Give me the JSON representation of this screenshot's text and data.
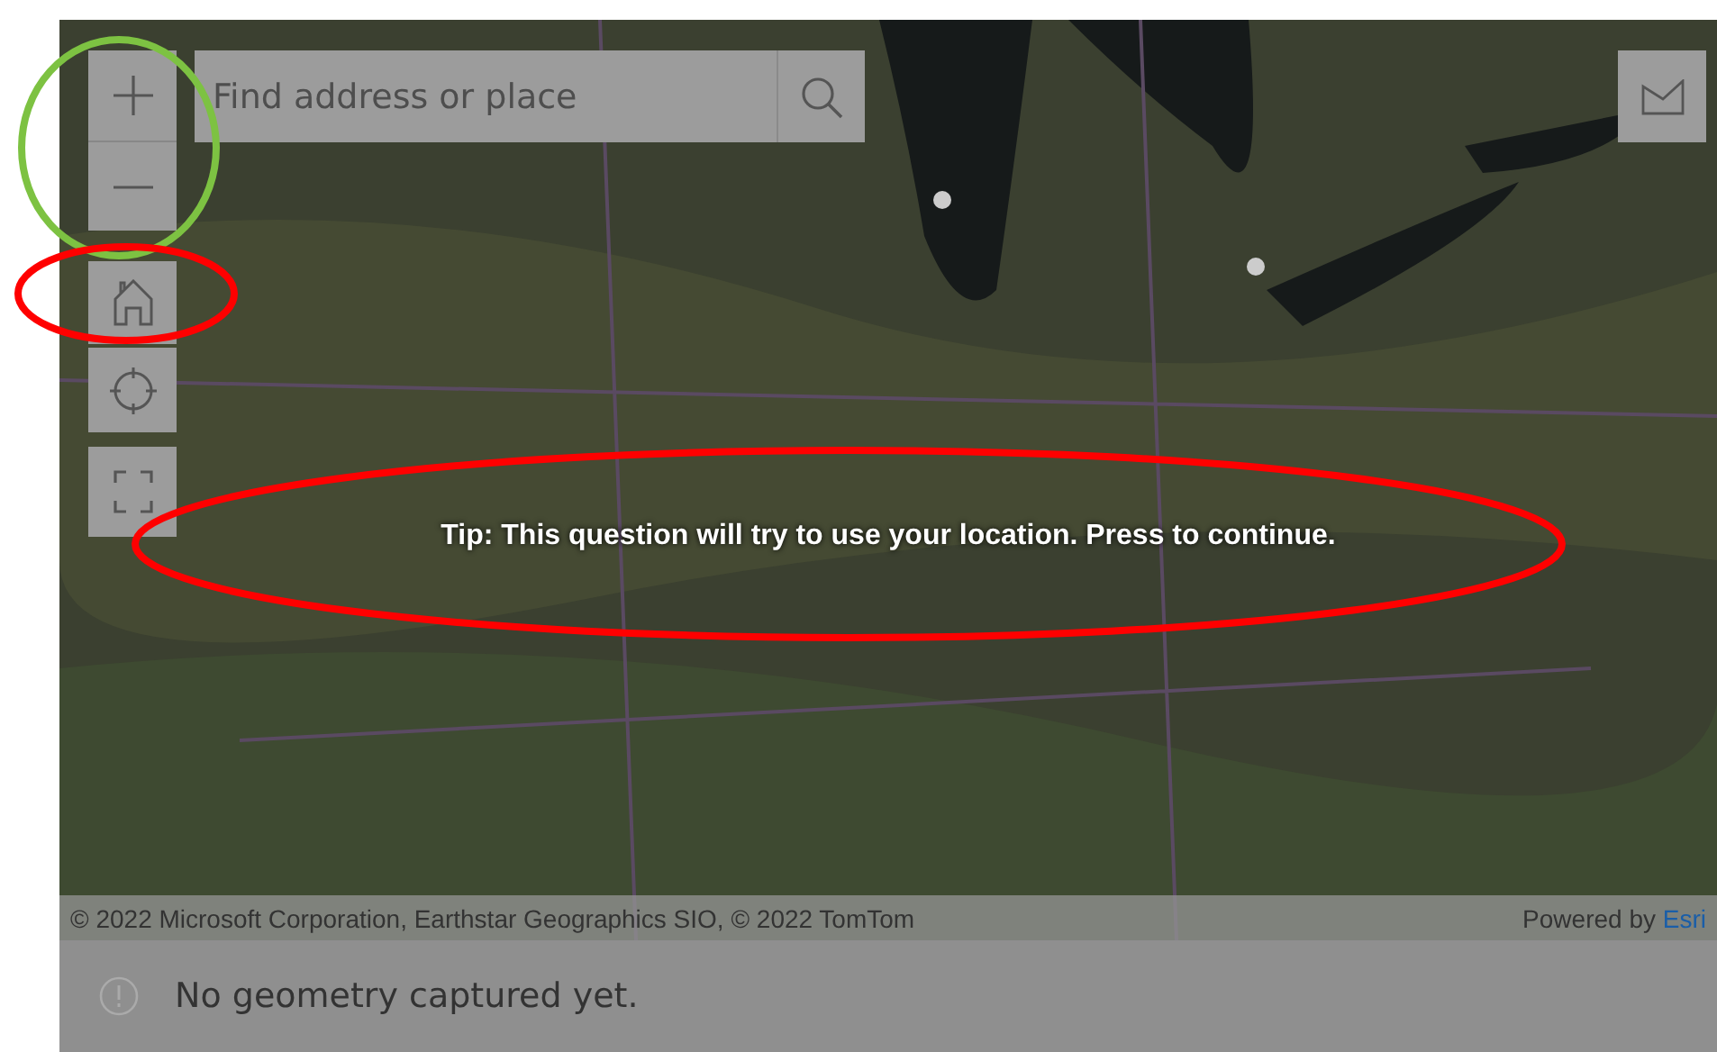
{
  "map": {
    "kind": "picture",
    "search": {
      "placeholder": "Find address or place"
    },
    "tip": "Tip: This question will try to use your location. Press to continue.",
    "attribution": "© 2022 Microsoft Corporation, Earthstar Geographics SIO, © 2022 TomTom",
    "powered_by": {
      "text": "Powered by",
      "link": "Esri"
    }
  },
  "status": {
    "message": "No geometry captured yet."
  },
  "annotations": [
    {
      "color": "#7dc242"
    },
    {
      "color": "#ff0000"
    },
    {
      "color": "#ff0000"
    }
  ]
}
